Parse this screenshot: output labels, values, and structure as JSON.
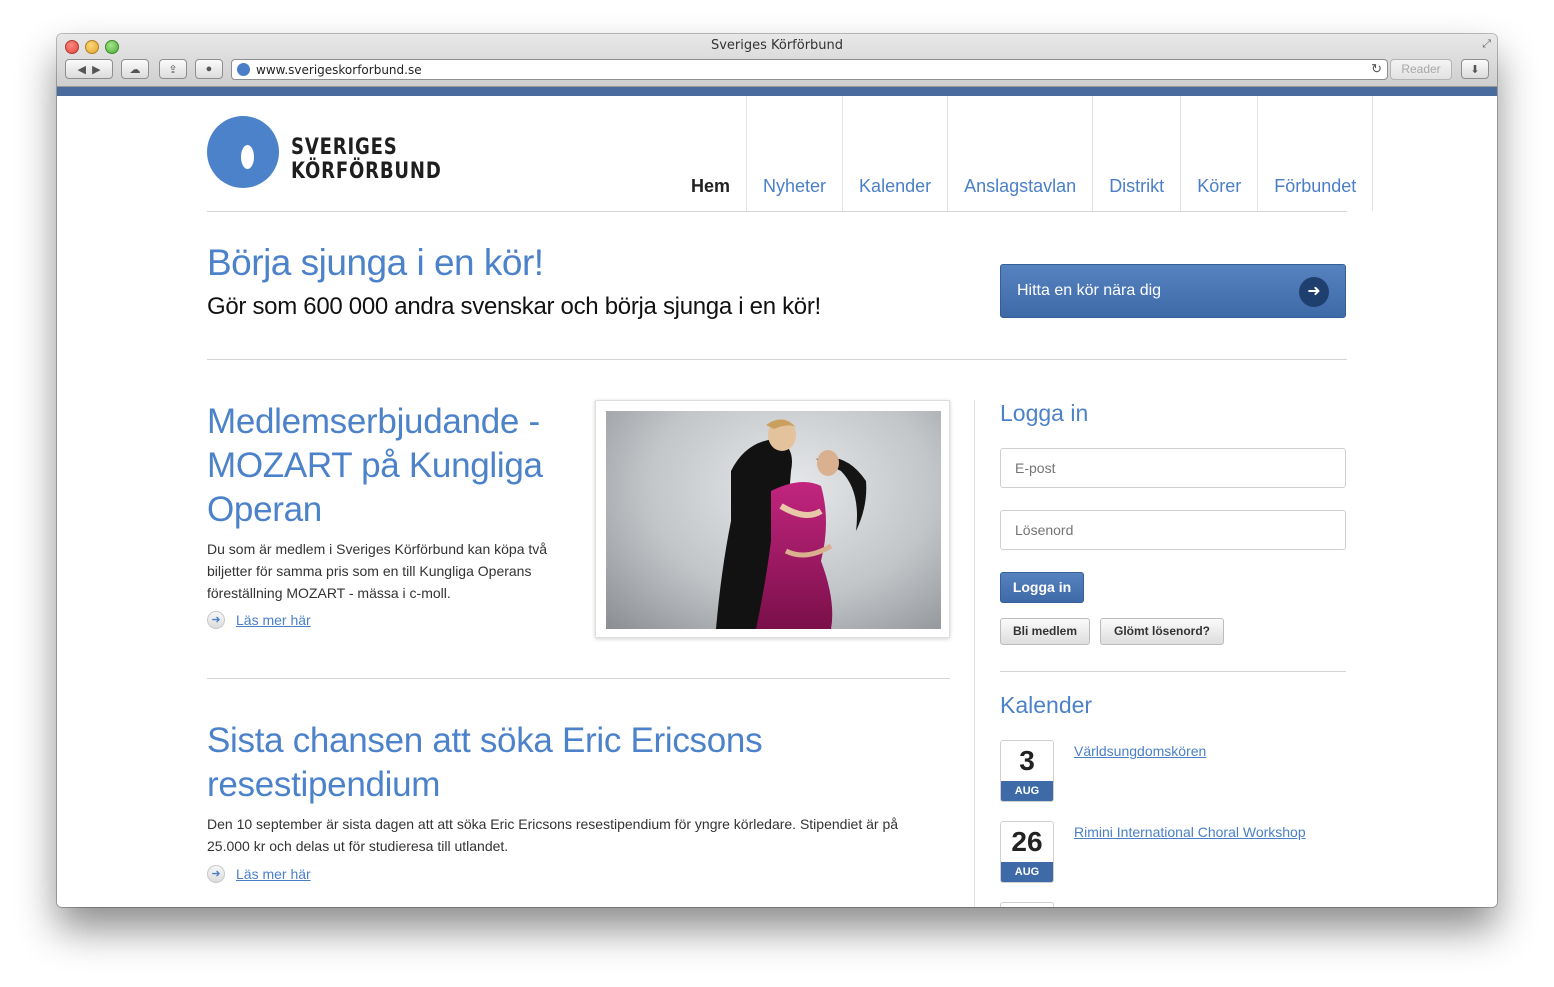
{
  "window": {
    "title": "Sveriges Körförbund",
    "url": "www.sverigeskorforbund.se",
    "reader_label": "Reader"
  },
  "logo": {
    "line1": "SVERIGES",
    "line2": "KÖRFÖRBUND",
    "color": "#4c82c9"
  },
  "nav": {
    "items": [
      {
        "label": "Hem",
        "active": true
      },
      {
        "label": "Nyheter"
      },
      {
        "label": "Kalender"
      },
      {
        "label": "Anslagstavlan"
      },
      {
        "label": "Distrikt"
      },
      {
        "label": "Körer"
      },
      {
        "label": "Förbundet"
      }
    ]
  },
  "hero": {
    "title": "Börja sjunga i en kör!",
    "subtitle": "Gör som 600 000 andra svenskar och börja sjunga i en kör!",
    "cta_label": "Hitta en kör nära dig"
  },
  "articles": [
    {
      "title_lines": [
        "Medlemserbjudande -",
        "MOZART på Kungliga",
        "Operan"
      ],
      "text_lines": [
        "Du som är medlem i Sveriges Körförbund kan köpa två",
        "biljetter för samma pris som en till Kungliga Operans",
        "föreställning MOZART - mässa i c-moll."
      ],
      "readmore": "Läs mer här"
    },
    {
      "title_lines": [
        "Sista chansen att söka Eric Ericsons",
        "resestipendium"
      ],
      "text_lines": [
        "Den 10 september är sista dagen att att söka Eric Ericsons resestipendium för yngre körledare. Stipendiet är på",
        "25.000 kr och delas ut för studieresa till utlandet."
      ],
      "readmore": "Läs mer här"
    }
  ],
  "login": {
    "heading": "Logga in",
    "email_placeholder": "E-post",
    "password_placeholder": "Lösenord",
    "submit_label": "Logga in",
    "member_label": "Bli medlem",
    "forgot_label": "Glömt lösenord?"
  },
  "calendar": {
    "heading": "Kalender",
    "events": [
      {
        "day": "3",
        "month": "AUG",
        "title": "Världsungdomskören"
      },
      {
        "day": "26",
        "month": "AUG",
        "title": "Rimini International Choral Workshop"
      }
    ]
  },
  "colors": {
    "brand_blue": "#4c82c9",
    "button_blue": "#3e6aa8",
    "top_bar": "#4a6b9e"
  }
}
